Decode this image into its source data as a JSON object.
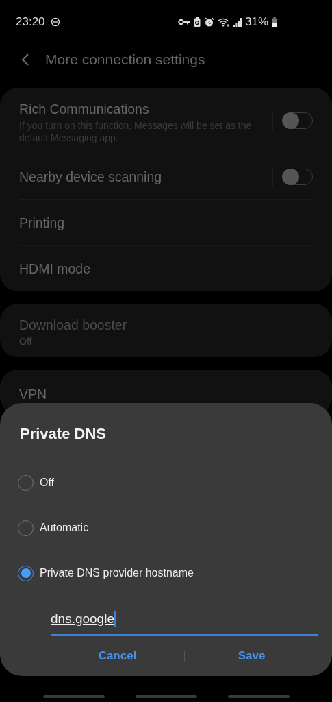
{
  "status_bar": {
    "time": "23:20",
    "battery_text": "31%"
  },
  "header": {
    "title": "More connection settings"
  },
  "groups": [
    {
      "items": [
        {
          "kind": "toggle",
          "title": "Rich Communications",
          "subtitle": "If you turn on this function, Messages will be set as the default Messaging app.",
          "on": false
        },
        {
          "kind": "toggle",
          "title": "Nearby device scanning",
          "on": false
        },
        {
          "kind": "plain",
          "title": "Printing"
        },
        {
          "kind": "plain",
          "title": "HDMI mode"
        }
      ]
    },
    {
      "items": [
        {
          "kind": "plain",
          "title": "Download booster",
          "subtitle": "Off",
          "disabled": true
        }
      ]
    },
    {
      "items": [
        {
          "kind": "plain",
          "title": "VPN"
        }
      ]
    }
  ],
  "dialog": {
    "title": "Private DNS",
    "options": [
      {
        "label": "Off",
        "selected": false
      },
      {
        "label": "Automatic",
        "selected": false
      },
      {
        "label": "Private DNS provider hostname",
        "selected": true
      }
    ],
    "hostname": {
      "value": "dns.google"
    },
    "buttons": [
      "Cancel",
      "Save"
    ]
  }
}
